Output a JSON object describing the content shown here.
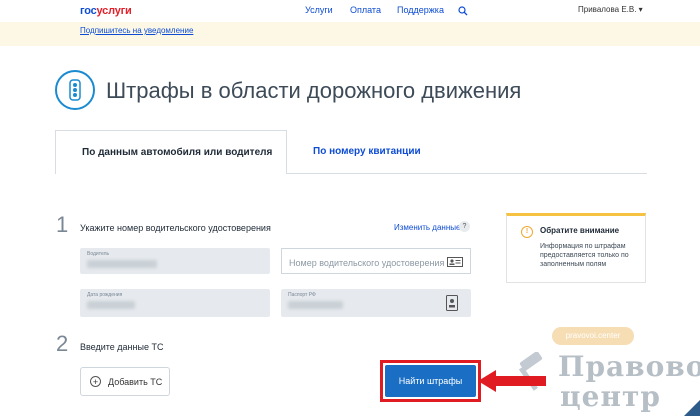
{
  "header": {
    "logo_part1": "гос",
    "logo_part2": "услуги",
    "nav": [
      "Услуги",
      "Оплата",
      "Поддержка"
    ],
    "user_name": "Привалова Е.В."
  },
  "notice": {
    "link": "Подпишитесь на уведомление"
  },
  "page": {
    "title": "Штрафы в области дорожного движения"
  },
  "tabs": [
    {
      "label": "По данным автомобиля или водителя",
      "active": true
    },
    {
      "label": "По номеру квитанции",
      "active": false
    }
  ],
  "step1": {
    "number": "1",
    "label": "Укажите номер водительского удостоверения",
    "change_link": "Изменить данные",
    "help": "?",
    "fields": {
      "driver_label": "Водитель",
      "license_placeholder": "Номер водительского удостоверения",
      "birth_label": "Дата рождения",
      "passport_label": "Паспорт РФ"
    }
  },
  "callout": {
    "title": "Обратите внимание",
    "text": "Информация по штрафам предоставляется только по заполненным полям",
    "icon": "!"
  },
  "step2": {
    "number": "2",
    "label": "Введите данные ТС",
    "add_button": "Добавить ТС",
    "find_button": "Найти штрафы"
  },
  "watermark": {
    "pill": "pravovoi.center",
    "line1": "Правовой",
    "line2": "центр"
  },
  "colors": {
    "brand_blue": "#0d4cd3",
    "brand_red": "#e4202a",
    "button_blue": "#1a6fc4",
    "highlight_red": "#e11b22",
    "warning_yellow": "#f5c242"
  }
}
